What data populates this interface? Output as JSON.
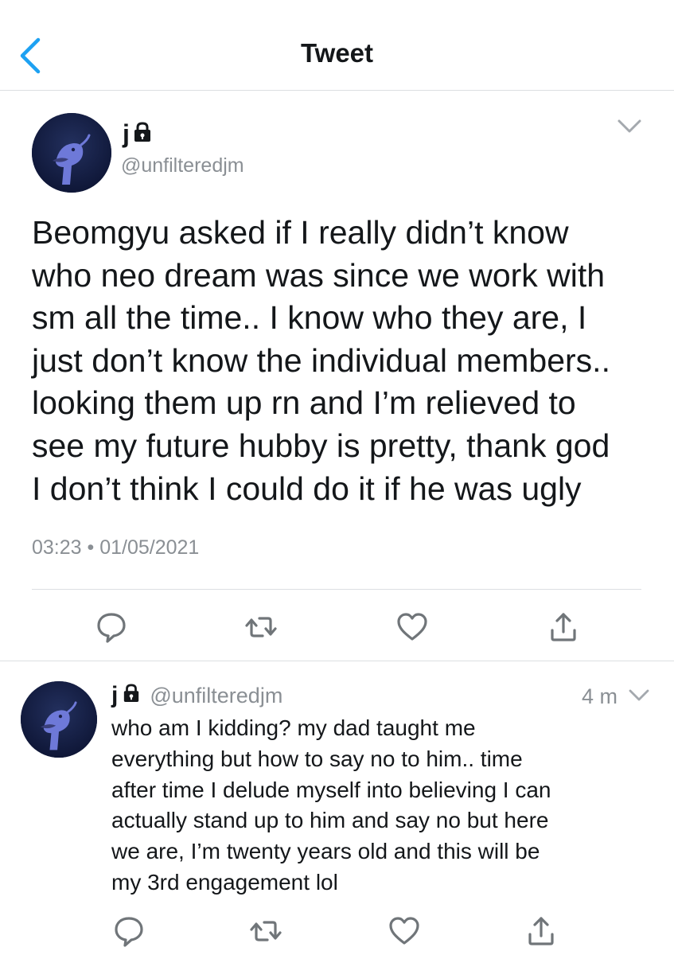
{
  "header": {
    "title": "Tweet"
  },
  "main_tweet": {
    "name": "j",
    "handle": "@unfilteredjm",
    "text": "Beomgyu asked if I really didn’t know\nwho neo dream was since we work with\nsm all the time.. I know who they are, I\njust don’t know the individual members..\nlooking them up rn and I’m relieved to\nsee my future hubby is pretty, thank god\nI don’t think I could do it if he was ugly",
    "time": "03:23",
    "date": "01/05/2021",
    "meta": "03:23 • 01/05/2021",
    "icons": [
      "reply-icon",
      "retweet-icon",
      "like-icon",
      "share-icon"
    ]
  },
  "reply_tweet": {
    "name": "j",
    "handle": "@unfilteredjm",
    "time": "4 m",
    "text": "who am I kidding? my dad taught me\neverything but how to say no to him.. time\nafter time I delude myself into believing I can\nactually stand up to him and say no but here\nwe are, I’m twenty years old and this will be\nmy 3rd engagement lol",
    "icons": [
      "reply-icon",
      "retweet-icon",
      "like-icon",
      "share-icon"
    ]
  },
  "colors": {
    "accent": "#1da1f2",
    "text": "#14171a",
    "secondary": "#8a8f94",
    "divider": "#dcdfe2",
    "avatar_bg": "#101a3e"
  }
}
